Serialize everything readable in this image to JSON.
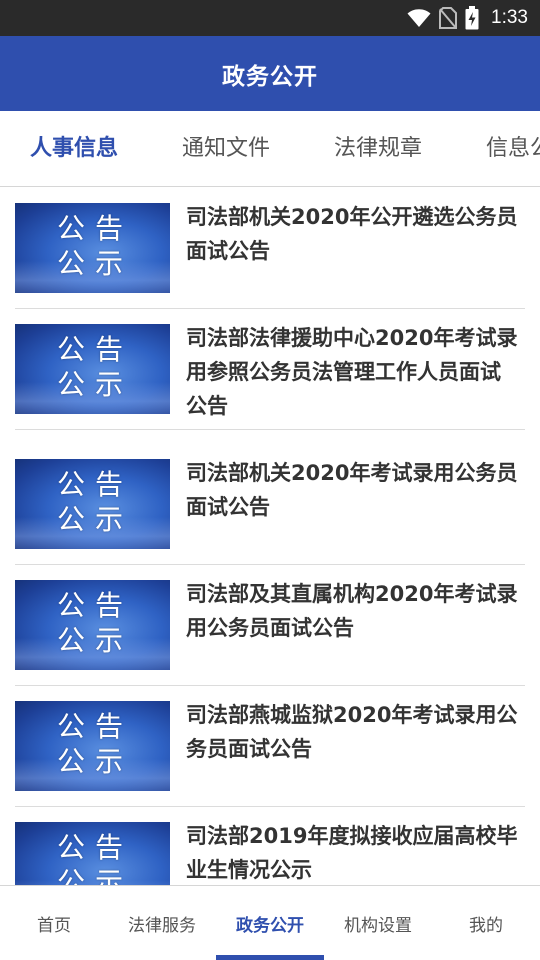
{
  "status_bar": {
    "time": "1:33",
    "icons": [
      "wifi-icon",
      "no-sim-icon",
      "battery-charging-icon"
    ]
  },
  "header": {
    "title": "政务公开"
  },
  "tabs": [
    {
      "label": "人事信息",
      "active": true
    },
    {
      "label": "通知文件",
      "active": false
    },
    {
      "label": "法律规章",
      "active": false
    },
    {
      "label": "信息公开",
      "active": false
    }
  ],
  "news": {
    "thumbnail_text": {
      "line1": "公告",
      "line2": "公示"
    },
    "items": [
      {
        "title": "司法部机关2020年公开遴选公务员面试公告"
      },
      {
        "title": "司法部法律援助中心2020年考试录用参照公务员法管理工作人员面试公告"
      },
      {
        "title": "司法部机关2020年考试录用公务员面试公告"
      },
      {
        "title": "司法部及其直属机构2020年考试录用公务员面试公告"
      },
      {
        "title": "司法部燕城监狱2020年考试录用公务员面试公告"
      },
      {
        "title": "司法部2019年度拟接收应届高校毕业生情况公示"
      }
    ]
  },
  "bottom_nav": [
    {
      "label": "首页",
      "active": false
    },
    {
      "label": "法律服务",
      "active": false
    },
    {
      "label": "政务公开",
      "active": true
    },
    {
      "label": "机构设置",
      "active": false
    },
    {
      "label": "我的",
      "active": false
    }
  ],
  "colors": {
    "primary": "#2f4fae",
    "status_bar": "#2a2a2a",
    "text_dark": "#333333",
    "text_muted": "#555555"
  }
}
